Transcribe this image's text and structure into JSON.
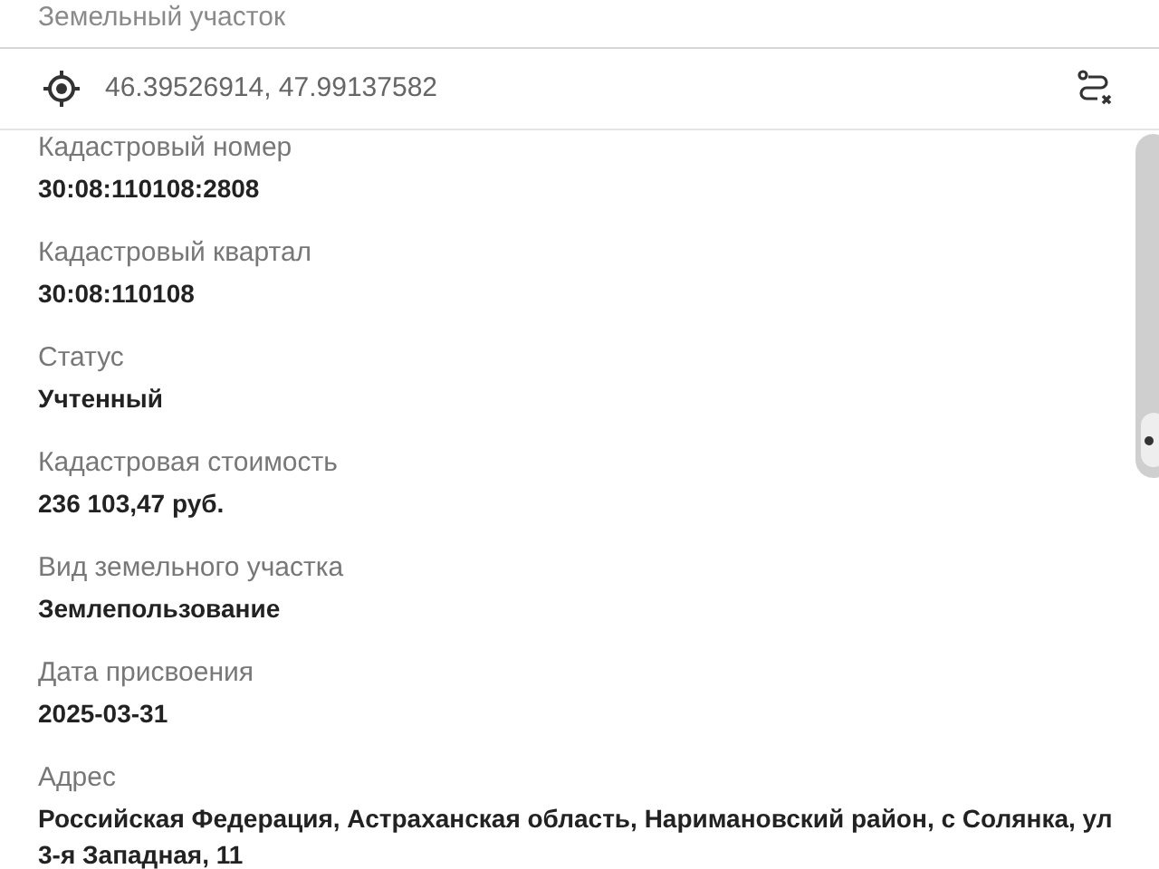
{
  "header": {
    "title": "Земельный участок"
  },
  "coordinates": {
    "text": "46.39526914, 47.99137582"
  },
  "fields": [
    {
      "label": "Кадастровый номер",
      "value": "30:08:110108:2808"
    },
    {
      "label": "Кадастровый квартал",
      "value": "30:08:110108"
    },
    {
      "label": "Статус",
      "value": "Учтенный"
    },
    {
      "label": "Кадастровая стоимость",
      "value": "236 103,47 руб."
    },
    {
      "label": "Вид земельного участка",
      "value": "Землепользование"
    },
    {
      "label": "Дата присвоения",
      "value": "2025-03-31"
    },
    {
      "label": "Адрес",
      "value": "Российская Федерация, Астраханская область, Наримановский район, с Солянка, ул 3-я Западная, 11"
    }
  ]
}
